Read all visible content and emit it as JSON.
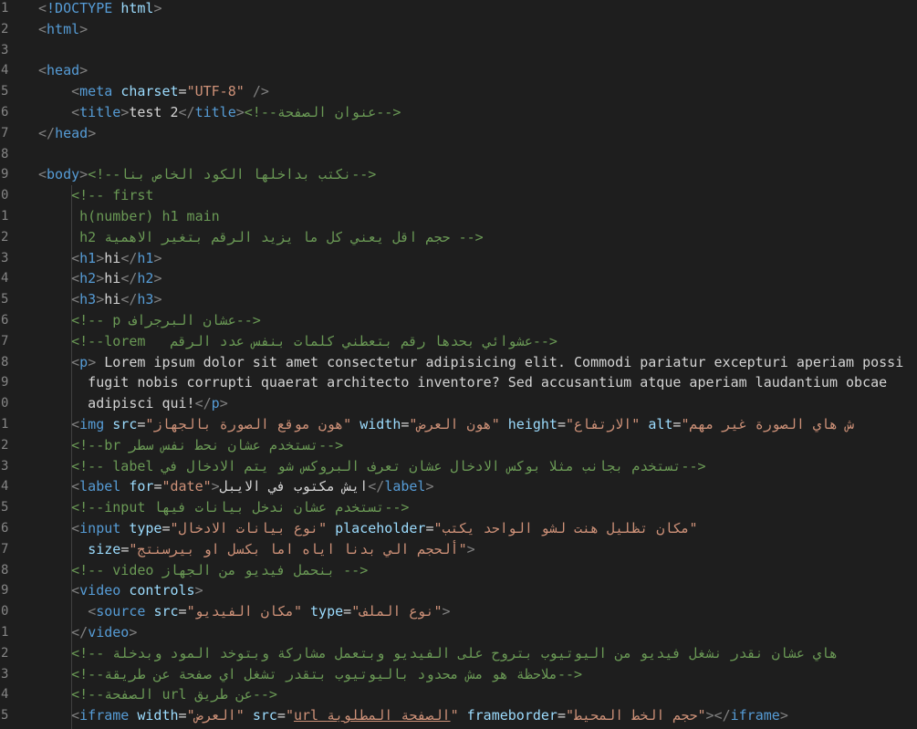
{
  "editor": {
    "theme_colors": {
      "background": "#1e1e1e",
      "tag": "#569cd6",
      "attribute": "#9cdcfe",
      "string": "#ce9178",
      "comment": "#6a9955",
      "text": "#d4d4d4",
      "line_number": "#858585"
    },
    "lines": [
      {
        "n": "1",
        "parts": [
          [
            "p",
            "<"
          ],
          [
            "t",
            "!DOCTYPE "
          ],
          [
            "a",
            "html"
          ],
          [
            "p",
            ">"
          ]
        ]
      },
      {
        "n": "2",
        "parts": [
          [
            "p",
            "<"
          ],
          [
            "t",
            "html"
          ],
          [
            "p",
            ">"
          ]
        ]
      },
      {
        "n": "3",
        "parts": []
      },
      {
        "n": "4",
        "parts": [
          [
            "p",
            "<"
          ],
          [
            "t",
            "head"
          ],
          [
            "p",
            ">"
          ]
        ]
      },
      {
        "n": "5",
        "parts": [
          [
            "tx",
            "    "
          ],
          [
            "p",
            "<"
          ],
          [
            "t",
            "meta "
          ],
          [
            "a",
            "charset"
          ],
          [
            "tx",
            "="
          ],
          [
            "s",
            "\"UTF-8\""
          ],
          [
            "tx",
            " "
          ],
          [
            "p",
            "/>"
          ]
        ]
      },
      {
        "n": "6",
        "parts": [
          [
            "tx",
            "    "
          ],
          [
            "p",
            "<"
          ],
          [
            "t",
            "title"
          ],
          [
            "p",
            ">"
          ],
          [
            "tx",
            "test 2"
          ],
          [
            "p",
            "</"
          ],
          [
            "t",
            "title"
          ],
          [
            "p",
            ">"
          ],
          [
            "c",
            "<!--عنوان الصفحة-->"
          ]
        ]
      },
      {
        "n": "7",
        "parts": [
          [
            "p",
            "</"
          ],
          [
            "t",
            "head"
          ],
          [
            "p",
            ">"
          ]
        ]
      },
      {
        "n": "8",
        "parts": []
      },
      {
        "n": "9",
        "parts": [
          [
            "p",
            "<"
          ],
          [
            "t",
            "body"
          ],
          [
            "p",
            ">"
          ],
          [
            "c",
            "<!--نكتب بداخلها الكود الخاص بنا-->"
          ]
        ]
      },
      {
        "n": "0",
        "parts": [
          [
            "tx",
            "    "
          ],
          [
            "c",
            "<!-- first"
          ]
        ]
      },
      {
        "n": "1",
        "parts": [
          [
            "tx",
            "     "
          ],
          [
            "c",
            "h(number) h1 main"
          ]
        ]
      },
      {
        "n": "2",
        "parts": [
          [
            "tx",
            "     "
          ],
          [
            "c",
            "h2 حجم اقل يعني كل ما يزيد الرقم بتغير الاهمية -->"
          ]
        ]
      },
      {
        "n": "3",
        "parts": [
          [
            "tx",
            "    "
          ],
          [
            "p",
            "<"
          ],
          [
            "t",
            "h1"
          ],
          [
            "p",
            ">"
          ],
          [
            "tx",
            "hi"
          ],
          [
            "p",
            "</"
          ],
          [
            "t",
            "h1"
          ],
          [
            "p",
            ">"
          ]
        ]
      },
      {
        "n": "4",
        "parts": [
          [
            "tx",
            "    "
          ],
          [
            "p",
            "<"
          ],
          [
            "t",
            "h2"
          ],
          [
            "p",
            ">"
          ],
          [
            "tx",
            "hi"
          ],
          [
            "p",
            "</"
          ],
          [
            "t",
            "h2"
          ],
          [
            "p",
            ">"
          ]
        ]
      },
      {
        "n": "5",
        "parts": [
          [
            "tx",
            "    "
          ],
          [
            "p",
            "<"
          ],
          [
            "t",
            "h3"
          ],
          [
            "p",
            ">"
          ],
          [
            "tx",
            "hi"
          ],
          [
            "p",
            "</"
          ],
          [
            "t",
            "h3"
          ],
          [
            "p",
            ">"
          ]
        ]
      },
      {
        "n": "6",
        "parts": [
          [
            "tx",
            "    "
          ],
          [
            "c",
            "<!-- p عشان البرجراف-->"
          ]
        ]
      },
      {
        "n": "7",
        "parts": [
          [
            "tx",
            "    "
          ],
          [
            "c",
            "<!--lorem   عشوائي بحدها رقم بتعطني كلمات بنفس عدد الرقم-->"
          ]
        ]
      },
      {
        "n": "8",
        "parts": [
          [
            "tx",
            "    "
          ],
          [
            "p",
            "<"
          ],
          [
            "t",
            "p"
          ],
          [
            "p",
            ">"
          ],
          [
            "tx",
            " Lorem ipsum dolor sit amet consectetur adipisicing elit. Commodi pariatur excepturi aperiam possi"
          ]
        ]
      },
      {
        "n": "9",
        "parts": [
          [
            "tx",
            "      fugit nobis corrupti quaerat architecto inventore? Sed accusantium atque aperiam laudantium obcae"
          ]
        ]
      },
      {
        "n": "0",
        "parts": [
          [
            "tx",
            "      adipisci qui!"
          ],
          [
            "p",
            "</"
          ],
          [
            "t",
            "p"
          ],
          [
            "p",
            ">"
          ]
        ]
      },
      {
        "n": "1",
        "parts": [
          [
            "tx",
            "    "
          ],
          [
            "p",
            "<"
          ],
          [
            "t",
            "img "
          ],
          [
            "a",
            "src"
          ],
          [
            "tx",
            "="
          ],
          [
            "s",
            "\"هون موقع الصورة بالجهاز\""
          ],
          [
            "tx",
            " "
          ],
          [
            "a",
            "width"
          ],
          [
            "tx",
            "="
          ],
          [
            "s",
            "\"هون العرض\""
          ],
          [
            "tx",
            " "
          ],
          [
            "a",
            "height"
          ],
          [
            "tx",
            "="
          ],
          [
            "s",
            "\"الارتفاع\""
          ],
          [
            "tx",
            " "
          ],
          [
            "a",
            "alt"
          ],
          [
            "tx",
            "="
          ],
          [
            "s",
            "\"ش هاي الصورة غير مهم"
          ]
        ]
      },
      {
        "n": "2",
        "parts": [
          [
            "tx",
            "    "
          ],
          [
            "c",
            "<!--br تستخدم عشان نحط نفس سطر-->"
          ]
        ]
      },
      {
        "n": "3",
        "parts": [
          [
            "tx",
            "    "
          ],
          [
            "c",
            "<!-- label تستخدم بجانب مثلا بوكس الادخال عشان تعرف البروكس شو يتم الادخال في-->"
          ]
        ]
      },
      {
        "n": "4",
        "parts": [
          [
            "tx",
            "    "
          ],
          [
            "p",
            "<"
          ],
          [
            "t",
            "label "
          ],
          [
            "a",
            "for"
          ],
          [
            "tx",
            "="
          ],
          [
            "s",
            "\"date\""
          ],
          [
            "p",
            ">"
          ],
          [
            "tx",
            "ايش مكتوب في الايبل"
          ],
          [
            "p",
            "</"
          ],
          [
            "t",
            "label"
          ],
          [
            "p",
            ">"
          ]
        ]
      },
      {
        "n": "5",
        "parts": [
          [
            "tx",
            "    "
          ],
          [
            "c",
            "<!--input تستخدم عشان ندخل بيانات فيها-->"
          ]
        ]
      },
      {
        "n": "6",
        "parts": [
          [
            "tx",
            "    "
          ],
          [
            "p",
            "<"
          ],
          [
            "t",
            "input "
          ],
          [
            "a",
            "type"
          ],
          [
            "tx",
            "="
          ],
          [
            "s",
            "\"نوع بيانات الادخال\""
          ],
          [
            "tx",
            " "
          ],
          [
            "a",
            "placeholder"
          ],
          [
            "tx",
            "="
          ],
          [
            "s",
            "\"مكان تظليل هنت لشو الواحد يكتب\""
          ]
        ]
      },
      {
        "n": "7",
        "parts": [
          [
            "tx",
            "      "
          ],
          [
            "a",
            "size"
          ],
          [
            "tx",
            "="
          ],
          [
            "s",
            "\"ألحجم الي بدنا اياه اما بكسل او بيرسنتج\""
          ],
          [
            "p",
            ">"
          ]
        ]
      },
      {
        "n": "8",
        "parts": [
          [
            "tx",
            "    "
          ],
          [
            "c",
            "<!-- video بنحمل فيديو من الجهاز -->"
          ]
        ]
      },
      {
        "n": "9",
        "parts": [
          [
            "tx",
            "    "
          ],
          [
            "p",
            "<"
          ],
          [
            "t",
            "video "
          ],
          [
            "a",
            "controls"
          ],
          [
            "p",
            ">"
          ]
        ]
      },
      {
        "n": "0",
        "parts": [
          [
            "tx",
            "      "
          ],
          [
            "p",
            "<"
          ],
          [
            "t",
            "source "
          ],
          [
            "a",
            "src"
          ],
          [
            "tx",
            "="
          ],
          [
            "s",
            "\"مكان الفيديو\""
          ],
          [
            "tx",
            " "
          ],
          [
            "a",
            "type"
          ],
          [
            "tx",
            "="
          ],
          [
            "s",
            "\"نوع الملف\""
          ],
          [
            "p",
            ">"
          ]
        ]
      },
      {
        "n": "1",
        "parts": [
          [
            "tx",
            "    "
          ],
          [
            "p",
            "</"
          ],
          [
            "t",
            "video"
          ],
          [
            "p",
            ">"
          ]
        ]
      },
      {
        "n": "2",
        "parts": [
          [
            "tx",
            "    "
          ],
          [
            "c",
            "<!-- هاي عشان نقدر نشغل فيديو من اليوتيوب بتروح على الفيديو وبتعمل مشاركة وبتوخد المود وبدخلة"
          ]
        ]
      },
      {
        "n": "3",
        "parts": [
          [
            "tx",
            "    "
          ],
          [
            "c",
            "<!--ملاحظة هو مش محدود باليوتيوب بتقدر تشغل اي صفحة عن طريقة-->"
          ]
        ]
      },
      {
        "n": "4",
        "parts": [
          [
            "tx",
            "    "
          ],
          [
            "c",
            "<!--الصفحة url عن طريق-->"
          ]
        ]
      },
      {
        "n": "5",
        "parts": [
          [
            "tx",
            "    "
          ],
          [
            "p",
            "<"
          ],
          [
            "t",
            "iframe "
          ],
          [
            "a",
            "width"
          ],
          [
            "tx",
            "="
          ],
          [
            "s",
            "\"العرض\""
          ],
          [
            "tx",
            " "
          ],
          [
            "a",
            "src"
          ],
          [
            "tx",
            "="
          ],
          [
            "s",
            "\""
          ],
          [
            "su",
            "url الصفحة المطلوبة"
          ],
          [
            "s",
            "\""
          ],
          [
            "tx",
            " "
          ],
          [
            "a",
            "frameborder"
          ],
          [
            "tx",
            "="
          ],
          [
            "s",
            "\"حجم الخط المحيط\""
          ],
          [
            "p",
            "></"
          ],
          [
            "t",
            "iframe"
          ],
          [
            "p",
            ">"
          ]
        ]
      }
    ]
  }
}
